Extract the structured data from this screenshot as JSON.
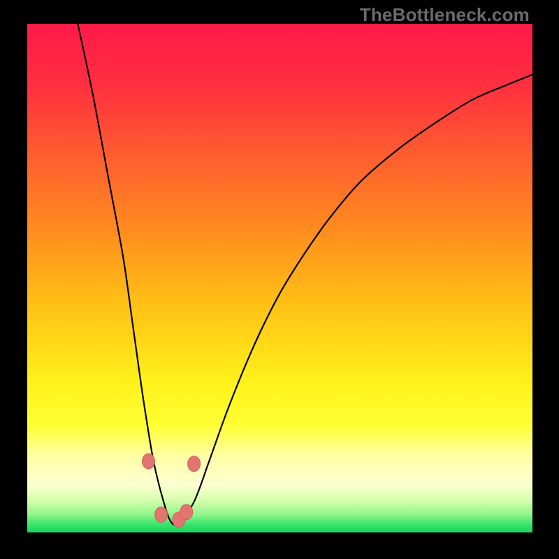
{
  "watermark": "TheBottleneck.com",
  "colors": {
    "black": "#000000",
    "curve": "#000000",
    "marker_fill": "#e2756f",
    "marker_stroke": "#d45f59",
    "gradient_stops": [
      {
        "offset": 0.0,
        "color": "#ff1a4a"
      },
      {
        "offset": 0.12,
        "color": "#ff2f3f"
      },
      {
        "offset": 0.25,
        "color": "#ff5a31"
      },
      {
        "offset": 0.4,
        "color": "#ff8a1f"
      },
      {
        "offset": 0.55,
        "color": "#ffc015"
      },
      {
        "offset": 0.7,
        "color": "#fff01a"
      },
      {
        "offset": 0.79,
        "color": "#ffff33"
      },
      {
        "offset": 0.85,
        "color": "#ffffa6"
      },
      {
        "offset": 0.905,
        "color": "#fcffd0"
      },
      {
        "offset": 0.935,
        "color": "#d9ffb0"
      },
      {
        "offset": 0.965,
        "color": "#8ff58a"
      },
      {
        "offset": 0.985,
        "color": "#36e36b"
      },
      {
        "offset": 1.0,
        "color": "#18d862"
      }
    ]
  },
  "chart_data": {
    "type": "line",
    "title": "",
    "xlabel": "",
    "ylabel": "",
    "xlim": [
      0,
      100
    ],
    "ylim": [
      0,
      100
    ],
    "grid": false,
    "series": [
      {
        "name": "bottleneck-curve",
        "x": [
          10,
          13,
          16,
          19,
          21,
          23,
          25,
          27,
          28.5,
          30,
          33,
          36,
          40,
          45,
          50,
          55,
          60,
          66,
          73,
          80,
          88,
          95,
          100
        ],
        "y": [
          100,
          86,
          70,
          54,
          40,
          26,
          14,
          6,
          2,
          2,
          6,
          14,
          25,
          37,
          47,
          55,
          62,
          69,
          75,
          80,
          85,
          88,
          90
        ]
      }
    ],
    "markers": [
      {
        "x": 24.0,
        "y": 14.0
      },
      {
        "x": 26.5,
        "y": 3.5
      },
      {
        "x": 30.0,
        "y": 2.5
      },
      {
        "x": 31.5,
        "y": 4.0
      },
      {
        "x": 33.0,
        "y": 13.5
      }
    ]
  }
}
